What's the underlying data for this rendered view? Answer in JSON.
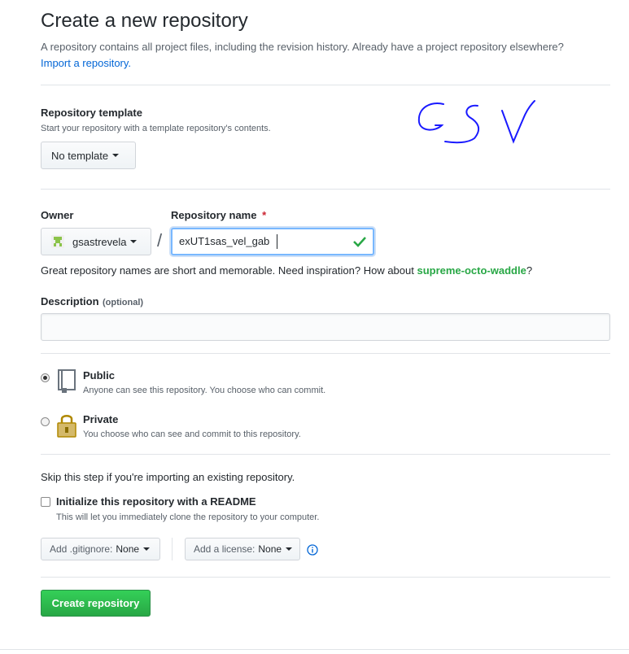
{
  "header": {
    "title": "Create a new repository",
    "subtitle": "A repository contains all project files, including the revision history. Already have a project repository elsewhere?",
    "import_link": "Import a repository."
  },
  "template": {
    "label": "Repository template",
    "note": "Start your repository with a template repository's contents.",
    "button": "No template"
  },
  "handwriting": "GSV",
  "owner": {
    "label": "Owner",
    "value": "gsastrevela"
  },
  "separator": "/",
  "repo_name": {
    "label": "Repository name",
    "required_mark": "*",
    "value": "exUT1sas_vel_gab"
  },
  "suggestion": {
    "text": "Great repository names are short and memorable. Need inspiration? How about ",
    "name": "supreme-octo-waddle",
    "end": "?"
  },
  "description": {
    "label": "Description",
    "optional": "(optional)",
    "value": ""
  },
  "visibility": {
    "public_title": "Public",
    "public_desc": "Anyone can see this repository. You choose who can commit.",
    "private_title": "Private",
    "private_desc": "You choose who can see and commit to this repository.",
    "selected": "public"
  },
  "init": {
    "skip_text": "Skip this step if you're importing an existing repository.",
    "readme_label": "Initialize this repository with a README",
    "readme_note": "This will let you immediately clone the repository to your computer."
  },
  "gitignore": {
    "label": "Add .gitignore:",
    "value": "None"
  },
  "license": {
    "label": "Add a license:",
    "value": "None"
  },
  "submit": {
    "label": "Create repository"
  },
  "colors": {
    "accent": "#28a745",
    "link": "#0366d6",
    "required": "#cb2431",
    "ink": "#1a1aff"
  }
}
